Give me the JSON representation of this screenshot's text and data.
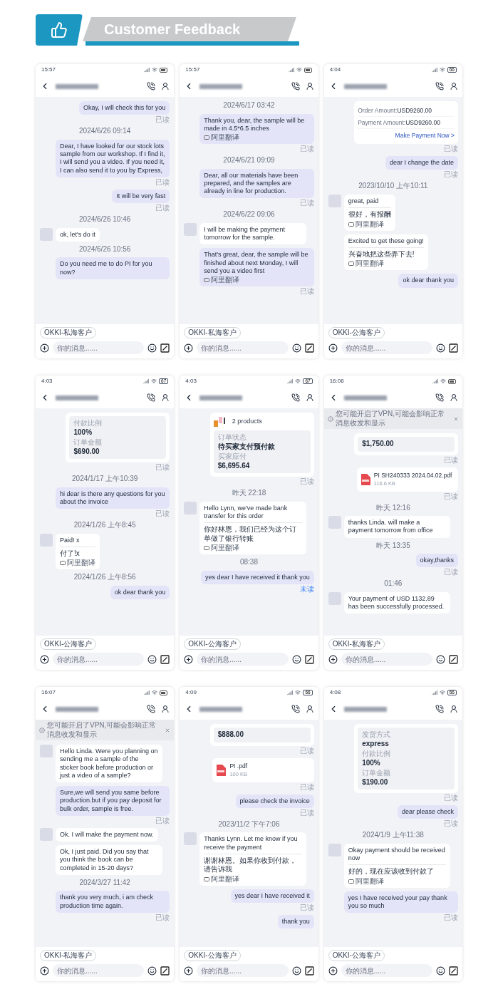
{
  "banner": {
    "title": "Customer Feedback"
  },
  "phones": [
    {
      "time": "15:57",
      "tag": "OKKI-私海客户",
      "placeholder": "你的消息......",
      "messages": [
        {
          "kind": "sent",
          "text": "Okay, I will check this for you",
          "receipt": {
            "text": "已读",
            "read": true
          }
        },
        {
          "kind": "date",
          "text": "2024/6/26 09:14"
        },
        {
          "kind": "sent",
          "text": "Dear, I have looked for our stock lots sample from our workshop. If I find it, I will send you a video. If you need it, I can also send it to you by Express,",
          "receipt": {
            "text": "已读",
            "read": true
          }
        },
        {
          "kind": "sent",
          "text": "It will be very fast",
          "receipt": {
            "text": "已读",
            "read": true
          }
        },
        {
          "kind": "date",
          "text": "2024/6/26 10:46"
        },
        {
          "kind": "received",
          "avatar": true,
          "text": "ok, let's do it"
        },
        {
          "kind": "date",
          "text": "2024/6/26 10:56"
        },
        {
          "kind": "sent",
          "text": "Do you need me to do PI for you now?"
        }
      ]
    },
    {
      "time": "15:57",
      "tag": "OKKI-私海客户",
      "placeholder": "你的消息......",
      "messages": [
        {
          "kind": "date",
          "text": "2024/6/17 03:42"
        },
        {
          "kind": "sent",
          "text": "Thank you, dear, the sample will be made in 4.5*6.5 inches",
          "translator": "阿里翻译",
          "receipt": {
            "text": "已读",
            "read": true
          }
        },
        {
          "kind": "date",
          "text": "2024/6/21 09:09"
        },
        {
          "kind": "sent",
          "text": "Dear, all our materials have been prepared, and the samples are already in line for production.",
          "receipt": {
            "text": "已读",
            "read": true
          }
        },
        {
          "kind": "date",
          "text": "2024/6/22 09:06"
        },
        {
          "kind": "received",
          "avatar": true,
          "text": "I will be making the payment tomorrow for the sample."
        },
        {
          "kind": "sent",
          "text": "That's great, dear, the sample will be finished about next Monday, I will send you a video first",
          "translator": "阿里翻译",
          "receipt": {
            "text": "已读",
            "read": true
          }
        }
      ]
    },
    {
      "time": "4:04",
      "battery": "66",
      "tag": "OKKI-公海客户",
      "placeholder": "你的消息......",
      "messages": [
        {
          "kind": "invoice",
          "fields": [
            {
              "label": "Order Amount:",
              "value": "USD9260.00"
            },
            {
              "label": "Payment Amount:",
              "value": "USD9260.00"
            }
          ],
          "link": "Make Payment Now >",
          "receipt": {
            "text": "已读",
            "read": true
          }
        },
        {
          "kind": "sent",
          "text": "dear I change the date",
          "receipt": {
            "text": "已读",
            "read": true
          }
        },
        {
          "kind": "date",
          "text": "2023/10/10 上午10:11"
        },
        {
          "kind": "received",
          "avatar": true,
          "text": "great, paid",
          "translation": "很好，有报酬",
          "translator": "阿里翻译"
        },
        {
          "kind": "received",
          "avatar": false,
          "text": "Excited to get these going!",
          "translation": "兴奋地把这些弄下去!",
          "translator": "阿里翻译"
        },
        {
          "kind": "sent",
          "text": "ok dear thank you"
        }
      ]
    },
    {
      "time": "4:03",
      "battery": "67",
      "tag": "OKKI-公海客户",
      "placeholder": "你的消息......",
      "messages": [
        {
          "kind": "card",
          "fields": [
            {
              "label": "付款比例",
              "value": "100%"
            },
            {
              "label": "订单金额",
              "value": "$690.00"
            }
          ],
          "receipt": {
            "text": "已读",
            "read": true
          }
        },
        {
          "kind": "date",
          "text": "2024/1/17 上午10:39"
        },
        {
          "kind": "sent",
          "text": "hi dear is there any questions for you about the invoice",
          "receipt": {
            "text": "已读",
            "read": true
          }
        },
        {
          "kind": "date",
          "text": "2024/1/26 上午8:45"
        },
        {
          "kind": "received",
          "avatar": true,
          "text": "Paid! x",
          "translation": "付了!x",
          "translator": "阿里翻译"
        },
        {
          "kind": "date",
          "text": "2024/1/26 上午8:56"
        },
        {
          "kind": "sent",
          "text": "ok dear thank you"
        }
      ]
    },
    {
      "time": "4:03",
      "battery": "67",
      "tag": "OKKI-公海客户",
      "placeholder": "你的消息......",
      "messages": [
        {
          "kind": "card",
          "products": "2 products",
          "fields": [
            {
              "label": "订单状态",
              "value": "待买家支付预付款"
            },
            {
              "label": "买家应付",
              "value": "$6,695.64"
            }
          ],
          "receipt": {
            "text": "已读",
            "read": true
          }
        },
        {
          "kind": "date",
          "text": "昨天 22:18"
        },
        {
          "kind": "received",
          "avatar": true,
          "text": "Hello Lynn, we've made bank transfer for this order",
          "translation": "你好林恩，我们已经为这个订单做了银行转账",
          "translator": "阿里翻译"
        },
        {
          "kind": "date",
          "text": "08:38"
        },
        {
          "kind": "sent",
          "text": "yes dear I have received it thank you",
          "receipt": {
            "text": "未读",
            "read": false
          }
        }
      ]
    },
    {
      "time": "16:06",
      "notice": "您可能开启了VPN,可能会影响正常消息收发和显示",
      "tag": "OKKI-私海客户",
      "placeholder": "你的消息......",
      "messages": [
        {
          "kind": "card",
          "fields": [
            {
              "value": "$1,750.00"
            }
          ],
          "receipt": {
            "text": "已读",
            "read": true
          }
        },
        {
          "kind": "file",
          "name": "PI SH240333 2024.04.02.pdf",
          "size": "116.6 KB",
          "receipt": {
            "text": "已读",
            "read": true
          }
        },
        {
          "kind": "date",
          "text": "昨天 12:16"
        },
        {
          "kind": "received",
          "avatar": true,
          "text": "thanks Linda. will make a payment tomorrow from office"
        },
        {
          "kind": "date",
          "text": "昨天 13:35"
        },
        {
          "kind": "sent",
          "text": "okay,thanks",
          "receipt": {
            "text": "已读",
            "read": true
          }
        },
        {
          "kind": "date",
          "text": "01:46"
        },
        {
          "kind": "received",
          "avatar": true,
          "text": "Your payment of USD 1132.89 has been successfully processed."
        }
      ]
    },
    {
      "time": "16:07",
      "notice": "您可能开启了VPN,可能会影响正常消息收发和显示",
      "tag": "OKKI-私海客户",
      "placeholder": "你的消息......",
      "messages": [
        {
          "kind": "received",
          "avatar": true,
          "text": "Hello Linda. Were you planning on sending me a sample of the sticker book before production or just a video of a sample?"
        },
        {
          "kind": "sent",
          "text": "Sure,we will send you same before production.but if you pay deposit for bulk order, sample is free.",
          "receipt": {
            "text": "已读",
            "read": true
          }
        },
        {
          "kind": "received",
          "avatar": true,
          "text": "Ok. I will make the payment now."
        },
        {
          "kind": "received",
          "avatar": false,
          "text": "Ok, I just paid. Did you say that you think the book can be completed in 15-20 days?"
        },
        {
          "kind": "date",
          "text": "2024/3/27 11:42"
        },
        {
          "kind": "sent",
          "text": "thank you very much, i am check production time again.",
          "receipt": {
            "text": "已读",
            "read": true
          }
        }
      ]
    },
    {
      "time": "4:09",
      "battery": "66",
      "tag": "OKKI-公海客户",
      "placeholder": "你的消息......",
      "messages": [
        {
          "kind": "card",
          "fields": [
            {
              "value": "$888.00"
            }
          ],
          "receipt": {
            "text": "已读",
            "read": true
          }
        },
        {
          "kind": "file",
          "name": "PI .pdf",
          "size": "100 KB",
          "receipt": {
            "text": "已读",
            "read": true
          }
        },
        {
          "kind": "sent",
          "text": "please check the invoice",
          "receipt": {
            "text": "已读",
            "read": true
          }
        },
        {
          "kind": "date",
          "text": "2023/11/2 下午7:06"
        },
        {
          "kind": "received",
          "avatar": true,
          "text": "Thanks Lynn. Let me know if you receive the payment",
          "translation": "谢谢林恩。如果你收到付款，请告诉我",
          "translator": "阿里翻译"
        },
        {
          "kind": "sent",
          "text": "yes dear I have received it",
          "receipt": {
            "text": "已读",
            "read": true
          }
        },
        {
          "kind": "sent",
          "text": "thank you"
        }
      ]
    },
    {
      "time": "4:08",
      "battery": "66",
      "tag": "OKKI-公海客户",
      "placeholder": "你的消息......",
      "messages": [
        {
          "kind": "card",
          "fields": [
            {
              "label": "发货方式",
              "value": "express"
            },
            {
              "label": "付款比例",
              "value": "100%"
            },
            {
              "label": "订单金额",
              "value": "$190.00"
            }
          ],
          "receipt": {
            "text": "已读",
            "read": true
          }
        },
        {
          "kind": "sent",
          "text": "dear please check",
          "receipt": {
            "text": "已读",
            "read": true
          }
        },
        {
          "kind": "date",
          "text": "2024/1/9 上午11:38"
        },
        {
          "kind": "received",
          "avatar": true,
          "text": "Okay payment should be received now",
          "translation": "好的，现在应该收到付款了",
          "translator": "阿里翻译"
        },
        {
          "kind": "sent",
          "text": "yes I have received your pay thank you so much",
          "receipt": {
            "text": "已读",
            "read": true
          }
        }
      ]
    }
  ]
}
